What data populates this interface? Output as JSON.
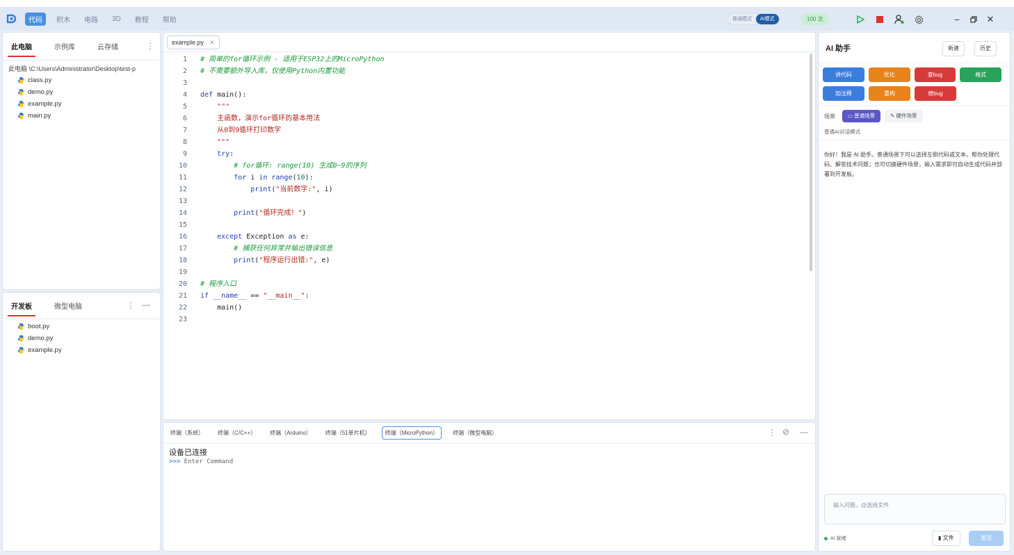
{
  "menubar": {
    "items": [
      {
        "label": "代码",
        "active": true
      },
      {
        "label": "积木",
        "active": false
      },
      {
        "label": "电路",
        "active": false
      },
      {
        "label": "3D",
        "active": false
      },
      {
        "label": "教程",
        "active": false
      },
      {
        "label": "帮助",
        "active": false
      }
    ],
    "modes": {
      "normal": "普通模式",
      "ai": "AI模式"
    },
    "count_badge": "100 次",
    "accent": "#4a90e2"
  },
  "left_panel": {
    "tabs": [
      "此电脑",
      "示例库",
      "云存储"
    ],
    "path": "此电脑 \\C:\\Users\\Administrator\\Desktop\\test-p",
    "files": [
      "class.py",
      "demo.py",
      "example.py",
      "main.py"
    ]
  },
  "board_panel": {
    "tabs": [
      "开发板",
      "微型电脑"
    ],
    "files": [
      "boot.py",
      "demo.py",
      "example.py"
    ]
  },
  "editor": {
    "tab": "example.py",
    "lines": [
      {
        "n": "1",
        "seg": [
          [
            "cm",
            "# 简单的for循环示例 - 适用于ESP32上的MicroPython"
          ]
        ]
      },
      {
        "n": "2",
        "seg": [
          [
            "cm",
            "# 不需要额外导入库，仅使用Python内置功能"
          ]
        ]
      },
      {
        "n": "3",
        "seg": []
      },
      {
        "n": "4",
        "seg": [
          [
            "kw",
            "def"
          ],
          [
            "plain",
            " main():"
          ]
        ]
      },
      {
        "n": "5",
        "seg": [
          [
            "str",
            "    \"\"\""
          ]
        ]
      },
      {
        "n": "6",
        "seg": [
          [
            "str",
            "    主函数，演示for循环的基本用法"
          ]
        ]
      },
      {
        "n": "7",
        "seg": [
          [
            "str",
            "    从0到9循环打印数字"
          ]
        ]
      },
      {
        "n": "8",
        "seg": [
          [
            "str",
            "    \"\"\""
          ]
        ]
      },
      {
        "n": "9",
        "seg": [
          [
            "kw",
            "    try"
          ],
          [
            "plain",
            ":"
          ]
        ]
      },
      {
        "n": "10",
        "seg": [
          [
            "cm",
            "        # for循环: range(10) 生成0~9的序列"
          ]
        ]
      },
      {
        "n": "11",
        "seg": [
          [
            "kw",
            "        for"
          ],
          [
            "plain",
            " i "
          ],
          [
            "kw",
            "in"
          ],
          [
            "kw",
            " range"
          ],
          [
            "plain",
            "("
          ],
          [
            "num",
            "10"
          ],
          [
            "plain",
            "):"
          ]
        ]
      },
      {
        "n": "12",
        "seg": [
          [
            "kw",
            "            print"
          ],
          [
            "plain",
            "("
          ],
          [
            "str",
            "\"当前数字:\""
          ],
          [
            "plain",
            ", i)"
          ]
        ]
      },
      {
        "n": "13",
        "seg": []
      },
      {
        "n": "14",
        "seg": [
          [
            "kw",
            "        print"
          ],
          [
            "plain",
            "("
          ],
          [
            "str",
            "\"循环完成！\""
          ],
          [
            "plain",
            ")"
          ]
        ]
      },
      {
        "n": "15",
        "seg": []
      },
      {
        "n": "16",
        "seg": [
          [
            "kw",
            "    except"
          ],
          [
            "plain",
            " Exception "
          ],
          [
            "kw",
            "as"
          ],
          [
            "plain",
            " e:"
          ]
        ]
      },
      {
        "n": "17",
        "seg": [
          [
            "cm",
            "        # 捕获任何异常并输出错误信息"
          ]
        ]
      },
      {
        "n": "18",
        "seg": [
          [
            "kw",
            "        print"
          ],
          [
            "plain",
            "("
          ],
          [
            "str",
            "\"程序运行出错:\""
          ],
          [
            "plain",
            ", e)"
          ]
        ]
      },
      {
        "n": "19",
        "seg": []
      },
      {
        "n": "20",
        "seg": [
          [
            "cm",
            "# 程序入口"
          ]
        ]
      },
      {
        "n": "21",
        "seg": [
          [
            "kw",
            "if"
          ],
          [
            "plain",
            " "
          ],
          [
            "kw",
            "__name__"
          ],
          [
            "plain",
            " == "
          ],
          [
            "str",
            "\"__main__\""
          ],
          [
            "plain",
            ":"
          ]
        ]
      },
      {
        "n": "22",
        "seg": [
          [
            "plain",
            "    main()"
          ]
        ]
      },
      {
        "n": "23",
        "seg": []
      }
    ]
  },
  "terminal": {
    "tabs": [
      "终端（系统）",
      "终端（C/C++）",
      "终端（Arduino）",
      "终端（51单片机）",
      "终端（MicroPython）",
      "终端（微型电脑）"
    ],
    "active_index": 4,
    "line1": "设备已连接",
    "prompt": ">>>",
    "placeholder": " Enter Command"
  },
  "ai": {
    "title": "AI 助手",
    "new_label": "新建",
    "history_label": "历史",
    "actions_row1": [
      {
        "label": "讲代码",
        "color": "blue"
      },
      {
        "label": "优化",
        "color": "orange"
      },
      {
        "label": "查bug",
        "color": "red"
      },
      {
        "label": "格式",
        "color": "green"
      }
    ],
    "actions_row2": [
      {
        "label": "加注释",
        "color": "blue"
      },
      {
        "label": "重构",
        "color": "orange"
      },
      {
        "label": "修bug",
        "color": "red"
      }
    ],
    "scene_label": "场景",
    "scene_normal": "普通场景",
    "scene_hw": "硬件场景",
    "scene_desc": "普通AI对话模式",
    "message": "你好！我是 AI 助手。普通场景下可以选择左侧代码或文本，帮你处理代码、解答技术问题；也可切换硬件场景，输入需求即可自动生成代码并部署到开发板。",
    "input_placeholder": "输入问题，@选择文件",
    "status": "AI 就绪",
    "file_btn": "文件",
    "send_btn": "发送"
  }
}
